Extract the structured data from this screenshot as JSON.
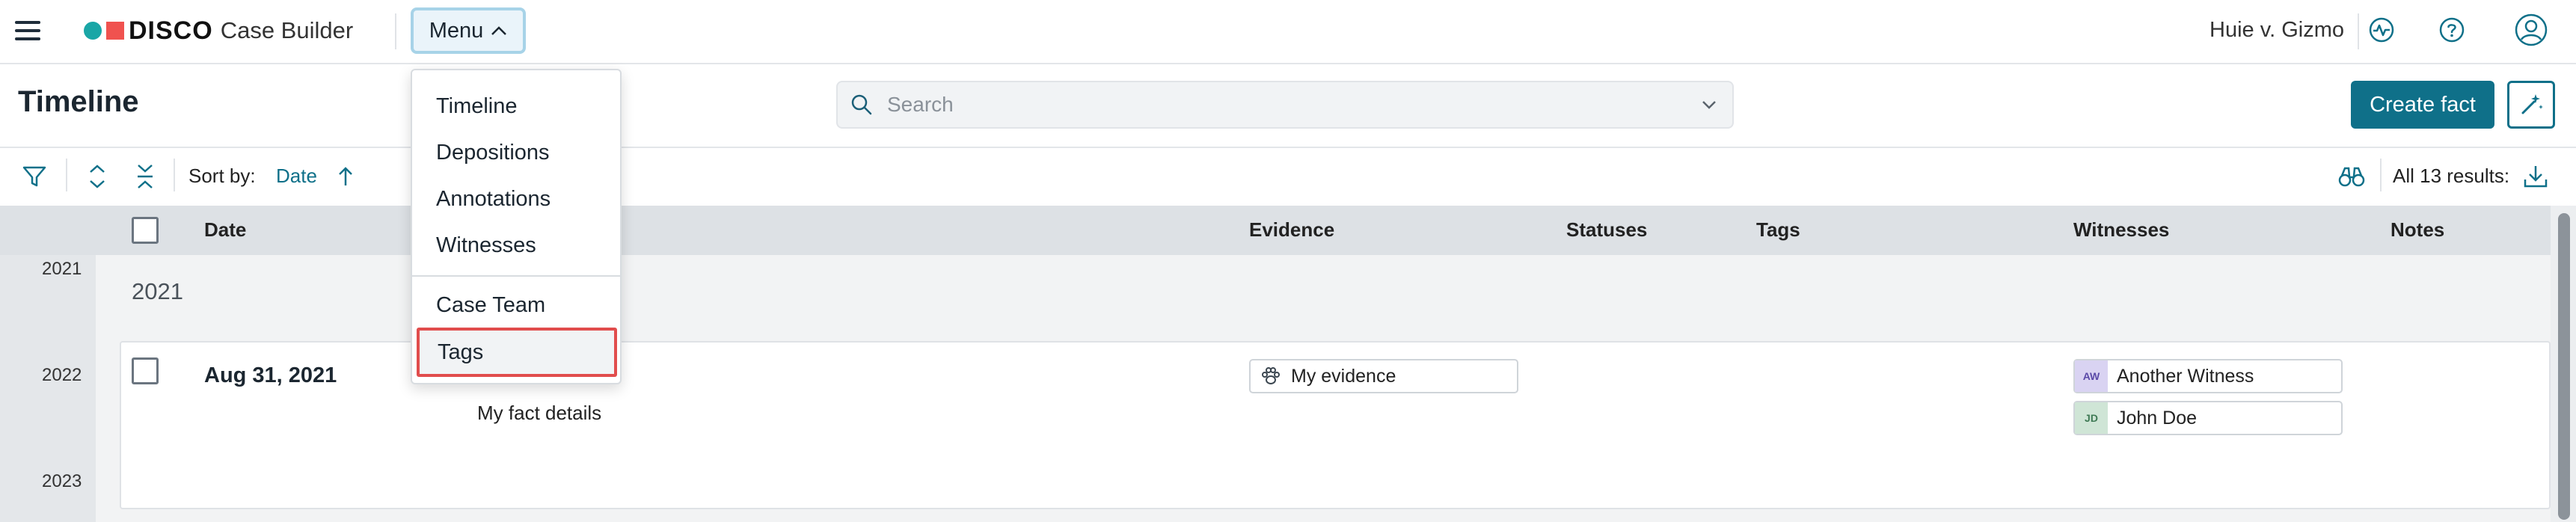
{
  "app": {
    "brand": "DISCO",
    "product": "Case Builder",
    "case_name": "Huie v. Gizmo"
  },
  "header": {
    "menu_label": "Menu"
  },
  "menu": {
    "items": [
      "Timeline",
      "Depositions",
      "Annotations",
      "Witnesses",
      "Case Team",
      "Tags"
    ],
    "highlighted": "Tags"
  },
  "page": {
    "title": "Timeline",
    "search_placeholder": "Search",
    "create_button": "Create fact"
  },
  "toolbar": {
    "sort_by_label": "Sort by:",
    "sort_value": "Date",
    "results_label": "All 13 results:"
  },
  "table": {
    "columns": {
      "date": "Date",
      "evidence": "Evidence",
      "statuses": "Statuses",
      "tags": "Tags",
      "witnesses": "Witnesses",
      "notes": "Notes"
    },
    "year_markers": [
      "2021",
      "2022",
      "2023"
    ],
    "group_label": "2021",
    "rows": [
      {
        "date": "Aug 31, 2021",
        "details": "My fact details",
        "evidence": "My evidence",
        "witnesses": [
          {
            "initials": "AW",
            "name": "Another Witness",
            "color": "#d9d3f2",
            "text_color": "#5b4aa8"
          },
          {
            "initials": "JD",
            "name": "John Doe",
            "color": "#cfe5d6",
            "text_color": "#3f7a55"
          }
        ]
      }
    ]
  },
  "colors": {
    "accent": "#0f7089",
    "highlight_border": "#e14d4d",
    "logo_teal": "#1aa6a6",
    "logo_red": "#f0524f"
  }
}
